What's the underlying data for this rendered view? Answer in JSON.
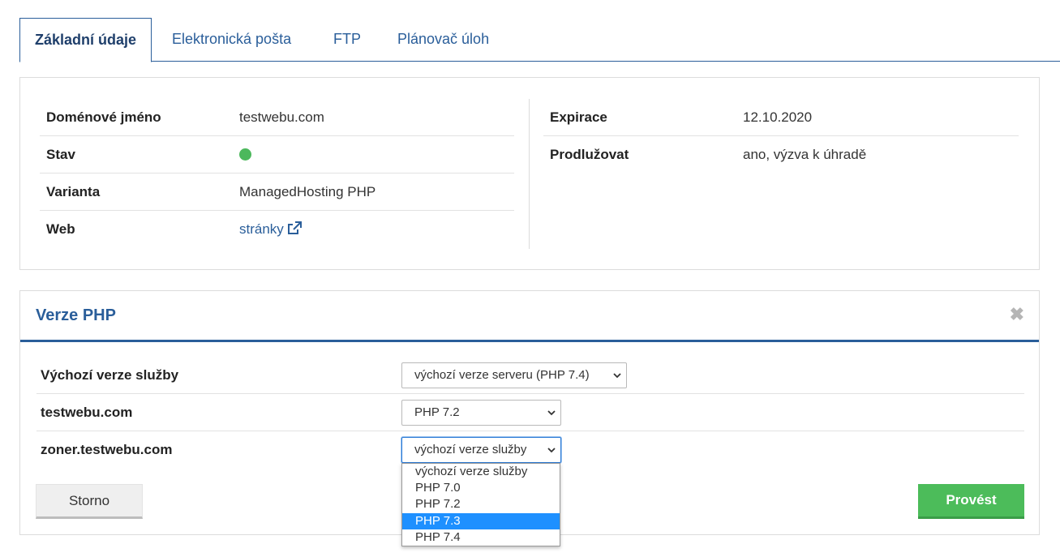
{
  "tabs": [
    {
      "label": "Základní údaje",
      "active": true
    },
    {
      "label": "Elektronická pošta",
      "active": false
    },
    {
      "label": "FTP",
      "active": false
    },
    {
      "label": "Plánovač úloh",
      "active": false
    }
  ],
  "info": {
    "left": [
      {
        "label": "Doménové jméno",
        "value": "testwebu.com"
      },
      {
        "label": "Stav",
        "value": ""
      },
      {
        "label": "Varianta",
        "value": "ManagedHosting PHP"
      },
      {
        "label": "Web",
        "value": "stránky"
      }
    ],
    "right": [
      {
        "label": "Expirace",
        "value": "12.10.2020"
      },
      {
        "label": "Prodlužovat",
        "value": "ano, výzva k úhradě"
      }
    ],
    "status_color": "#4cb85c"
  },
  "php": {
    "title": "Verze PHP",
    "rows": [
      {
        "label": "Výchozí verze služby",
        "selected": "výchozí verze serveru (PHP 7.4)"
      },
      {
        "label": "testwebu.com",
        "selected": "PHP 7.2"
      },
      {
        "label": "zoner.testwebu.com",
        "selected": "výchozí verze služby"
      }
    ],
    "dropdown_options": [
      "výchozí verze služby",
      "PHP 7.0",
      "PHP 7.2",
      "PHP 7.3",
      "PHP 7.4"
    ],
    "dropdown_highlighted": "PHP 7.3",
    "cancel_label": "Storno",
    "submit_label": "Provést"
  },
  "colors": {
    "accent": "#2a5e9a",
    "success": "#4cbc5a",
    "highlight": "#1e90ff"
  }
}
